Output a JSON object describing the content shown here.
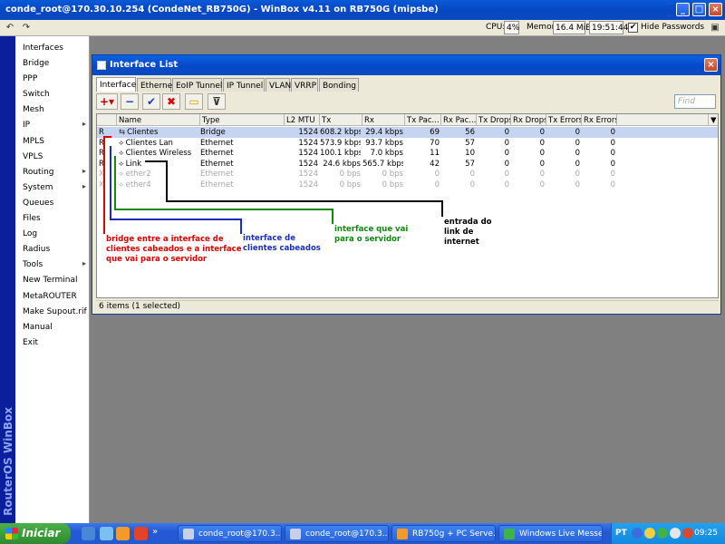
{
  "main_window": {
    "title": "conde_root@170.30.10.254 (CondeNet_RB750G) - WinBox v4.11 on RB750G (mipsbe)"
  },
  "toolbar": {
    "cpu_label": "CPU:",
    "cpu_value": "4%",
    "memory_label": "Memory:",
    "memory_value": "16.4 MiB",
    "time_value": "19:51:44",
    "hide_passwords_label": "Hide Passwords",
    "hide_passwords_checked": true
  },
  "sidebar": {
    "brand": "RouterOS WinBox",
    "items": [
      {
        "label": "Interfaces",
        "submenu": false
      },
      {
        "label": "Bridge",
        "submenu": false
      },
      {
        "label": "PPP",
        "submenu": false
      },
      {
        "label": "Switch",
        "submenu": false
      },
      {
        "label": "Mesh",
        "submenu": false
      },
      {
        "label": "IP",
        "submenu": true
      },
      {
        "label": "MPLS",
        "submenu": false
      },
      {
        "label": "VPLS",
        "submenu": false
      },
      {
        "label": "Routing",
        "submenu": true
      },
      {
        "label": "System",
        "submenu": true
      },
      {
        "label": "Queues",
        "submenu": false
      },
      {
        "label": "Files",
        "submenu": false
      },
      {
        "label": "Log",
        "submenu": false
      },
      {
        "label": "Radius",
        "submenu": false
      },
      {
        "label": "Tools",
        "submenu": true
      },
      {
        "label": "New Terminal",
        "submenu": false
      },
      {
        "label": "MetaROUTER",
        "submenu": false
      },
      {
        "label": "Make Supout.rif",
        "submenu": false
      },
      {
        "label": "Manual",
        "submenu": false
      },
      {
        "label": "Exit",
        "submenu": false
      }
    ]
  },
  "interface_window": {
    "title": "Interface List",
    "tabs": [
      "Interface",
      "Ethernet",
      "EoIP Tunnel",
      "IP Tunnel",
      "VLAN",
      "VRRP",
      "Bonding"
    ],
    "active_tab": "Interface",
    "find_placeholder": "Find",
    "columns": [
      "Name",
      "Type",
      "L2 MTU",
      "Tx",
      "Rx",
      "Tx Pac...",
      "Rx Pac...",
      "Tx Drops",
      "Rx Drops",
      "Tx Errors",
      "Rx Errors"
    ],
    "rows": [
      {
        "flag": "R",
        "name": "Clientes",
        "type": "Bridge",
        "l2mtu": "1524",
        "tx": "608.2 kbps",
        "rx": "29.4 kbps",
        "txp": "69",
        "rxp": "56",
        "txd": "0",
        "rxd": "0",
        "txe": "0",
        "rxe": "0",
        "selected": true,
        "disabled": false,
        "icon": "bridge-icon"
      },
      {
        "flag": "R",
        "name": "Clientes Lan",
        "type": "Ethernet",
        "l2mtu": "1524",
        "tx": "573.9 kbps",
        "rx": "93.7 kbps",
        "txp": "70",
        "rxp": "57",
        "txd": "0",
        "rxd": "0",
        "txe": "0",
        "rxe": "0",
        "selected": false,
        "disabled": false,
        "icon": "ethernet-icon"
      },
      {
        "flag": "R",
        "name": "Clientes Wireless",
        "type": "Ethernet",
        "l2mtu": "1524",
        "tx": "100.1 kbps",
        "rx": "7.0 kbps",
        "txp": "11",
        "rxp": "10",
        "txd": "0",
        "rxd": "0",
        "txe": "0",
        "rxe": "0",
        "selected": false,
        "disabled": false,
        "icon": "ethernet-icon"
      },
      {
        "flag": "R",
        "name": "Link",
        "type": "Ethernet",
        "l2mtu": "1524",
        "tx": "24.6 kbps",
        "rx": "565.7 kbps",
        "txp": "42",
        "rxp": "57",
        "txd": "0",
        "rxd": "0",
        "txe": "0",
        "rxe": "0",
        "selected": false,
        "disabled": false,
        "icon": "ethernet-icon"
      },
      {
        "flag": "X",
        "name": "ether2",
        "type": "Ethernet",
        "l2mtu": "1524",
        "tx": "0 bps",
        "rx": "0 bps",
        "txp": "0",
        "rxp": "0",
        "txd": "0",
        "rxd": "0",
        "txe": "0",
        "rxe": "0",
        "selected": false,
        "disabled": true,
        "icon": "ethernet-icon"
      },
      {
        "flag": "X",
        "name": "ether4",
        "type": "Ethernet",
        "l2mtu": "1524",
        "tx": "0 bps",
        "rx": "0 bps",
        "txp": "0",
        "rxp": "0",
        "txd": "0",
        "rxd": "0",
        "txe": "0",
        "rxe": "0",
        "selected": false,
        "disabled": true,
        "icon": "ethernet-icon"
      }
    ],
    "status": "6 items (1 selected)"
  },
  "annotations": [
    {
      "text": "bridge entre a interface de\nclientes cabeados e a interface\nque vai para o servidor",
      "color": "#e00000"
    },
    {
      "text": "interface de\nclientes cabeados",
      "color": "#1a2fb8"
    },
    {
      "text": "interface que vai\npara o servidor",
      "color": "#0f8a0f"
    },
    {
      "text": "entrada do\nlink de\ninternet",
      "color": "#000000"
    }
  ],
  "taskbar": {
    "start_label": "Iniciar",
    "tasks": [
      "conde_root@170.3...",
      "conde_root@170.3...",
      "RB750g + PC Serve...",
      "Windows Live Messe..."
    ],
    "language": "PT",
    "clock": "09:25"
  },
  "colors": {
    "title_blue": "#0548c7",
    "brand_blue": "#0b1e9c",
    "selected_row": "#c5d4f1",
    "taskbar_blue": "#245ad0",
    "start_green": "#2f8a2f"
  }
}
